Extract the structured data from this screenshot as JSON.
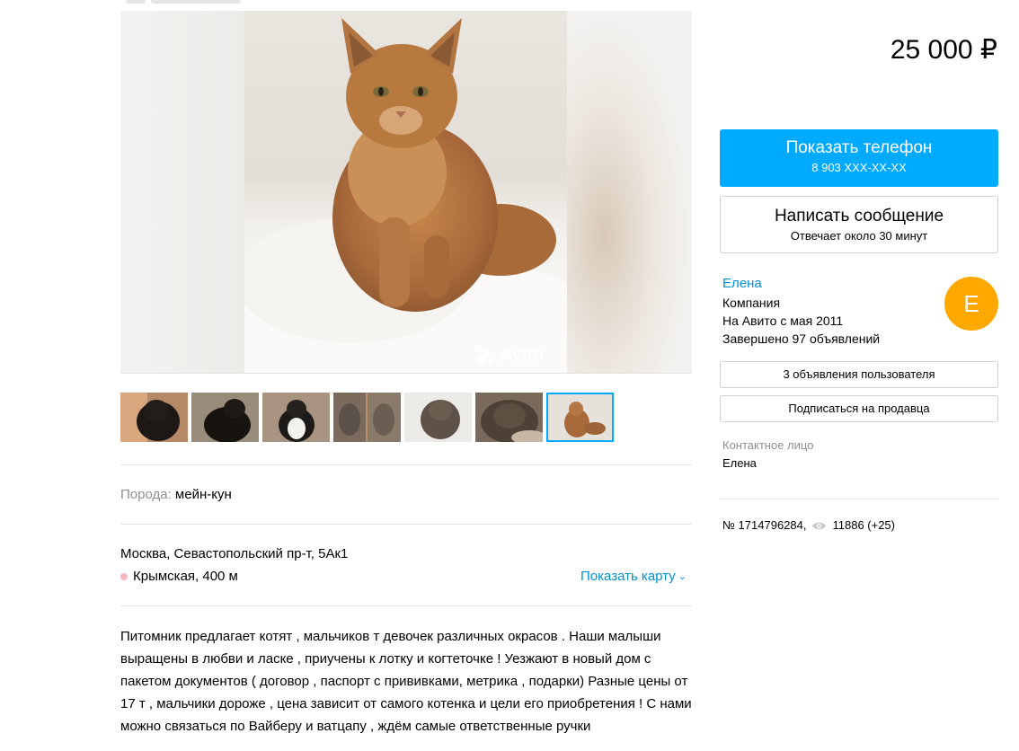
{
  "listing": {
    "price": "25 000 ₽",
    "param_label": "Порода:",
    "param_value": "мейн-кун",
    "address": "Москва, Севастопольский пр-т, 5Ак1",
    "metro": "Крымская, 400 м",
    "show_map": "Показать карту",
    "description": "Питомник предлагает котят , мальчиков т девочек различных окрасов . Наши малыши выращены в любви и ласке , приучены к лотку и когтеточке ! Уезжают в новый дом с пакетом документов ( договор , паспорт с прививками, метрика , подарки) Разные цены от 17 т , мальчики дороже , цена зависит от самого котенка и цели его приобретения ! С нами можно связаться по Вайберу и ватцапу , ждём самые ответственные ручки"
  },
  "photo": {
    "watermark": "Avito",
    "thumb_icons": [
      "black-kitten-photo",
      "black-kitten-photo",
      "black-white-kitten-photo",
      "tabby-kittens-photo",
      "tabby-kitten-photo",
      "tabby-cat-photo",
      "red-kitten-photo"
    ],
    "active_thumb": 7
  },
  "actions": {
    "show_phone": "Показать телефон",
    "phone_masked": "8 903 XXX-XX-XX",
    "write_message": "Написать сообщение",
    "response_time": "Отвечает около 30 минут"
  },
  "seller": {
    "name": "Елена",
    "type": "Компания",
    "since": "На Авито с мая 2011",
    "completed": "Завершено 97 объявлений",
    "avatar_letter": "Е",
    "avatar_color": "#ffa800",
    "other_ads": "3 объявления пользователя",
    "subscribe": "Подписаться на продавца",
    "contact_label": "Контактное лицо",
    "contact_name": "Елена"
  },
  "meta": {
    "ad_number": "№ 1714796284,",
    "views": "11886 (+25)"
  },
  "colors": {
    "accent": "#00aaff",
    "link": "#0091d9",
    "avatar": "#ffa800"
  }
}
